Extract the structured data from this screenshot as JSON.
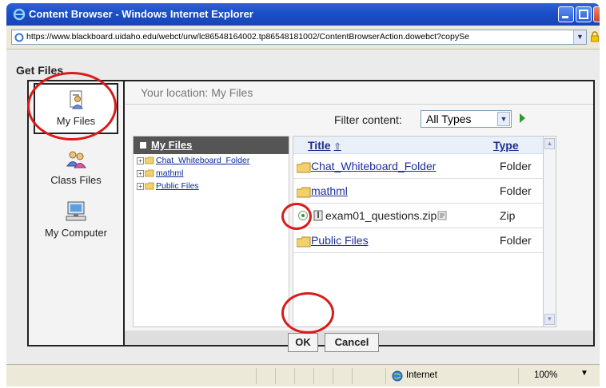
{
  "window": {
    "title": "Content Browser - Windows Internet Explorer"
  },
  "address": {
    "url": "https://www.blackboard.uidaho.edu/webct/urw/lc86548164002.tp86548181002/ContentBrowserAction.dowebct?copySe"
  },
  "page": {
    "heading": "Get Files"
  },
  "nav": {
    "items": [
      {
        "label": "My Files",
        "icon": "my-files-icon"
      },
      {
        "label": "Class Files",
        "icon": "class-files-icon"
      },
      {
        "label": "My Computer",
        "icon": "my-computer-icon"
      }
    ]
  },
  "location": {
    "text": "Your location: My Files"
  },
  "filter": {
    "label": "Filter content:",
    "value": "All Types"
  },
  "tree": {
    "title": "My Files",
    "items": [
      {
        "label": "Chat_Whiteboard_Folder"
      },
      {
        "label": "mathml"
      },
      {
        "label": "Public Files"
      }
    ]
  },
  "list": {
    "columns": {
      "title": "Title",
      "type": "Type"
    },
    "rows": [
      {
        "name": "Chat_Whiteboard_Folder",
        "type": "Folder"
      },
      {
        "name": "mathml",
        "type": "Folder"
      },
      {
        "name": "exam01_questions.zip",
        "type": "Zip"
      },
      {
        "name": "Public Files",
        "type": "Folder"
      }
    ]
  },
  "buttons": {
    "ok": "OK",
    "cancel": "Cancel"
  },
  "status": {
    "zone": "Internet",
    "zoom": "100%"
  },
  "colors": {
    "titlebar": "#1a4fc8",
    "highlight": "#d91b1b",
    "link": "#1d2f9a"
  }
}
